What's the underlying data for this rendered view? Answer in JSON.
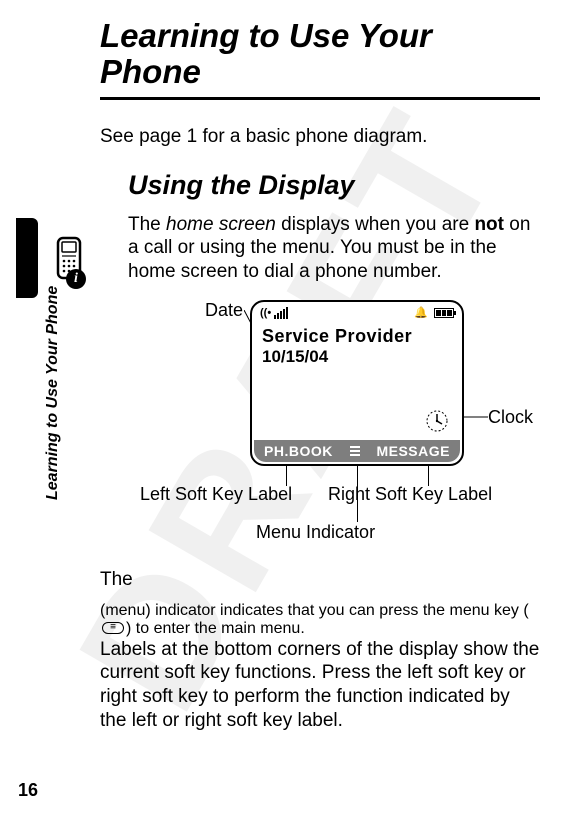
{
  "watermark": "DRAFT",
  "title": "Learning to Use Your Phone",
  "intro": "See page 1 for a basic phone diagram.",
  "section_title": "Using the Display",
  "para1_a": "The ",
  "para1_b": "home screen",
  "para1_c": " displays when you are ",
  "para1_d": "not",
  "para1_e": " on a call or using the menu. You must be in the home screen to dial a phone number.",
  "sidebar": "Learning to Use Your Phone",
  "page_number": "16",
  "diagram": {
    "labels": {
      "date": "Date",
      "clock": "Clock",
      "left_soft": "Left Soft Key Label",
      "right_soft": "Right Soft Key Label",
      "menu_ind": "Menu Indicator"
    },
    "screen": {
      "provider": "Service Provider",
      "date": "10/15/04",
      "left_soft": "PH.BOOK",
      "right_soft": "MESSAGE"
    }
  },
  "para2_a": "The ",
  "para2_b": " (menu) indicator indicates that you can press the menu key (",
  "para2_c": ") to enter the main menu.",
  "para3": "Labels at the bottom corners of the display show the current soft key functions. Press the left soft key or right soft key to perform the function indicated by the left or right soft key label."
}
